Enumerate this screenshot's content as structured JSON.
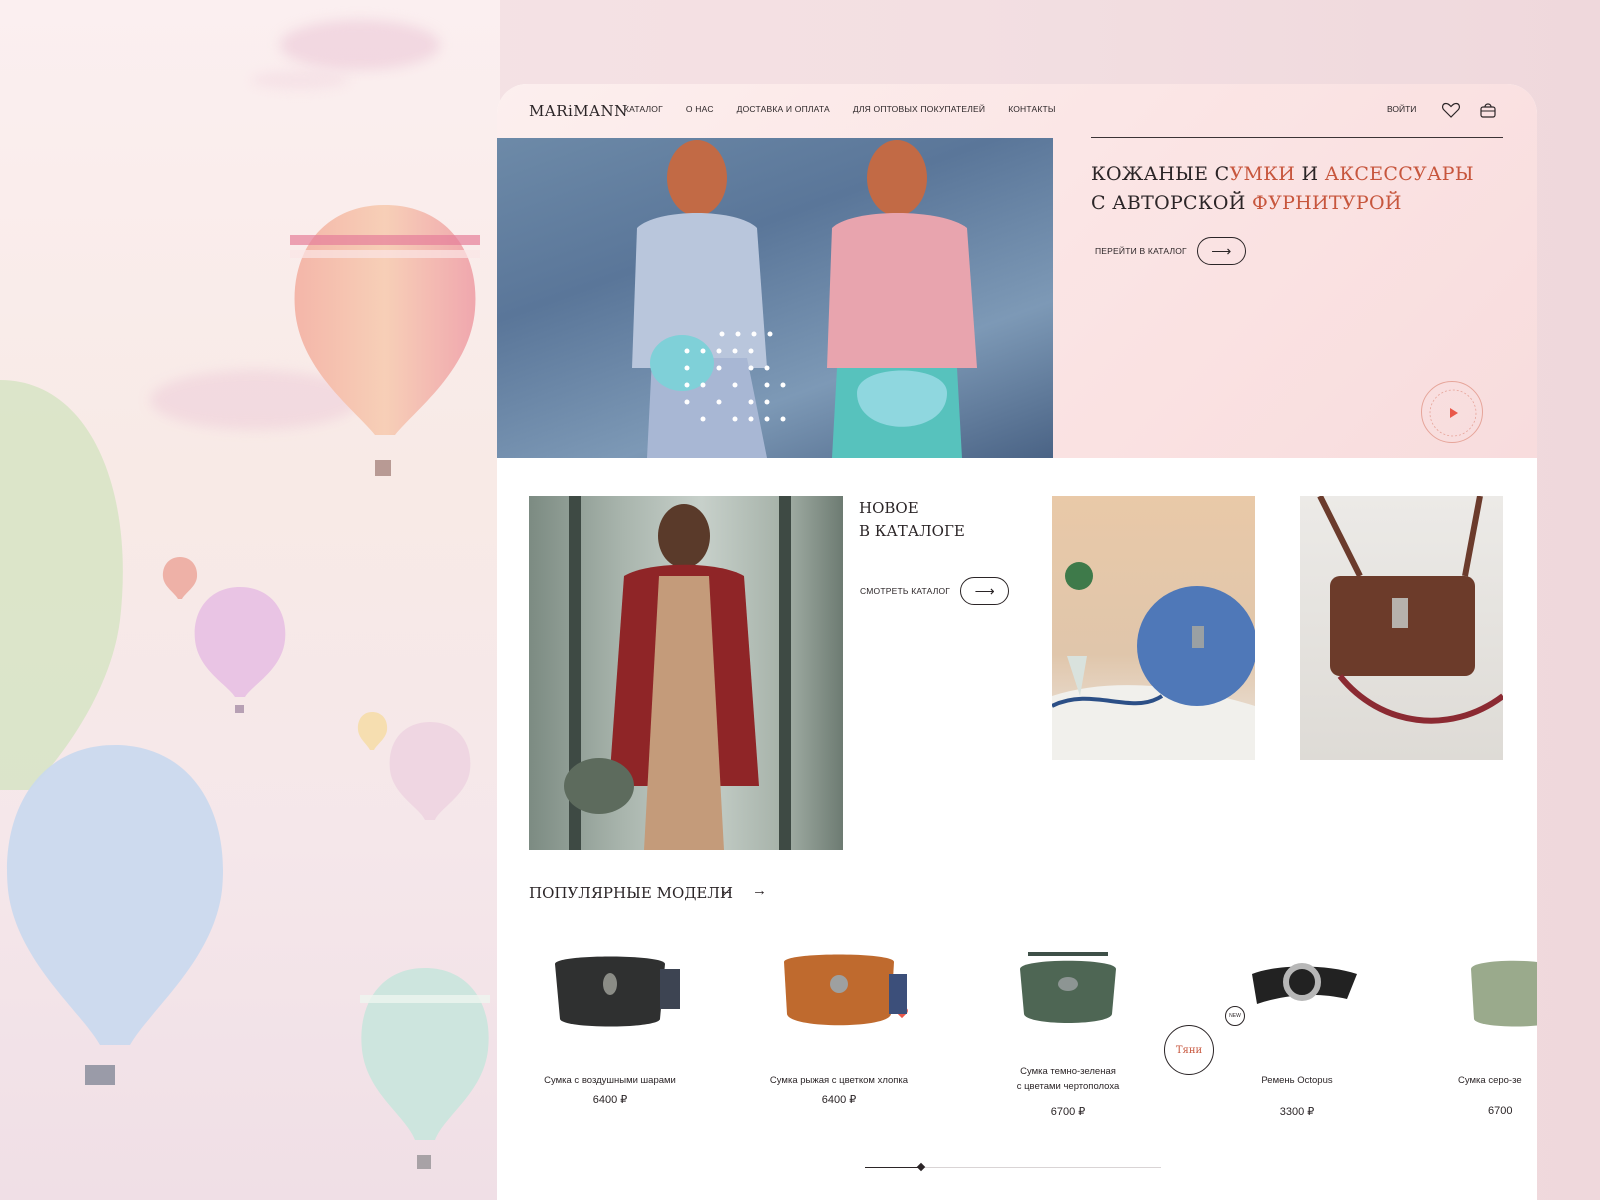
{
  "header": {
    "logo": "MARiMANN",
    "nav": [
      "КАТАЛОГ",
      "О НАС",
      "ДОСТАВКА И ОПЛАТА",
      "ДЛЯ ОПТОВЫХ ПОКУПАТЕЛЕЙ",
      "КОНТАКТЫ"
    ],
    "login": "ВОЙТИ"
  },
  "hero": {
    "title_part1": "КОЖАНЫЕ С",
    "title_part2": "УМКИ",
    "title_part3": " И ",
    "title_part4": "АКСЕССУАРЫ",
    "title_line2_part1": "С АВТОРСКОЙ ",
    "title_line2_part2": "ФУРНИТУРОЙ",
    "cta": "ПЕРЕЙТИ В КАТАЛОГ"
  },
  "new_section": {
    "title_line1": "НОВОЕ",
    "title_line2": "В КАТАЛОГЕ",
    "cta": "СМОТРЕТЬ КАТАЛОГ"
  },
  "popular": {
    "title": "ПОПУЛЯРНЫЕ МОДЕЛИ",
    "prev": "←",
    "next": "→",
    "drag_label": "Тяни",
    "products": [
      {
        "name": "Сумка с воздушными шарами",
        "price": "6400 ₽"
      },
      {
        "name": "Сумка рыжая с цветком хлопка",
        "price": "6400 ₽"
      },
      {
        "name_line1": "Сумка темно-зеленая",
        "name_line2": "с цветами чертополоха",
        "price": "6700 ₽"
      },
      {
        "name": "Ремень Octopus",
        "price": "3300 ₽",
        "badge": "NEW"
      },
      {
        "name": "Сумка серо-зе",
        "price": "6700"
      }
    ],
    "slider_progress": 0.19
  },
  "colors": {
    "accent": "#c7563d",
    "text": "#2b2527",
    "heart": "#e9584a"
  }
}
